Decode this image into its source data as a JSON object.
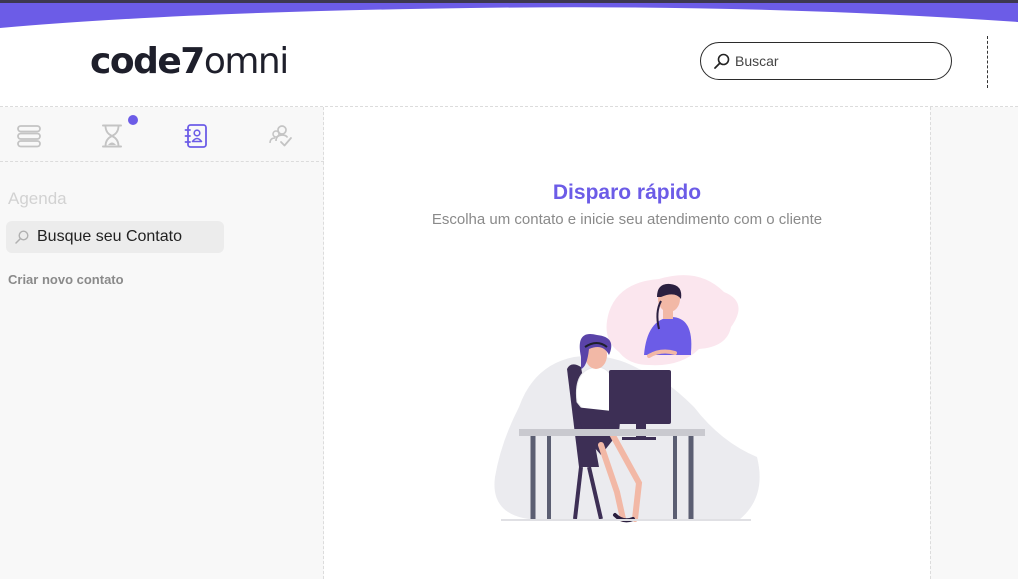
{
  "header": {
    "logo_bold": "code7",
    "logo_light": "omni",
    "search_placeholder": "Buscar",
    "accent_color": "#6c5ce7"
  },
  "sidebar": {
    "tabs": [
      {
        "icon": "stack-icon",
        "active": false
      },
      {
        "icon": "hourglass-icon",
        "active": false,
        "notification_dot": true
      },
      {
        "icon": "contact-book-icon",
        "active": true
      },
      {
        "icon": "user-check-icon",
        "active": false
      }
    ],
    "title": "Agenda",
    "contact_search_value": "Busque seu Contato",
    "create_contact_label": "Criar novo contato"
  },
  "main": {
    "title": "Disparo rápido",
    "subtitle": "Escolha um contato e inicie seu atendimento com o cliente",
    "illustration": "call-center-agent-illustration"
  }
}
